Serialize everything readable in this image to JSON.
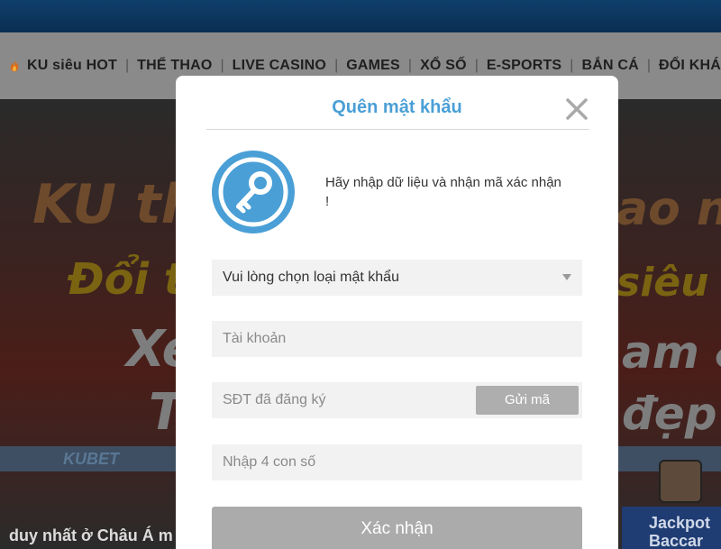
{
  "nav": {
    "items": [
      {
        "label": "KU siêu HOT",
        "icon": "fire-icon"
      },
      {
        "label": "THỂ THAO"
      },
      {
        "label": "LIVE CASINO"
      },
      {
        "label": "GAMES"
      },
      {
        "label": "XỔ SỐ"
      },
      {
        "label": "E-SPORTS"
      },
      {
        "label": "BẮN CÁ"
      },
      {
        "label": "ĐỔI KHÁ"
      }
    ]
  },
  "hero": {
    "line1": "KU th",
    "line1_right": "ao n",
    "line2": "Đổi ti",
    "line2_right": "siêu t",
    "line3": "Xe",
    "line3_right": "am &",
    "line4": "Tr",
    "line4_right": "đẹp",
    "brand_strip": "KUBET",
    "footer_text": "duy nhất ở Châu Á m",
    "jackpot_line1": "Jackpot",
    "jackpot_line2": "Baccar"
  },
  "modal": {
    "title": "Quên mật khẩu",
    "intro": "Hãy nhập dữ liệu và nhận mã xác nhận !",
    "password_type_select": "Vui lòng chọn loại mật khẩu",
    "account_placeholder": "Tài khoản",
    "phone_placeholder": "SĐT đã đăng ký",
    "send_code_label": "Gửi mã",
    "code_placeholder": "Nhập 4 con số",
    "submit_label": "Xác nhận"
  },
  "colors": {
    "accent": "#4a9fd6",
    "button_disabled": "#ababab",
    "field_bg": "#f2f2f2"
  }
}
